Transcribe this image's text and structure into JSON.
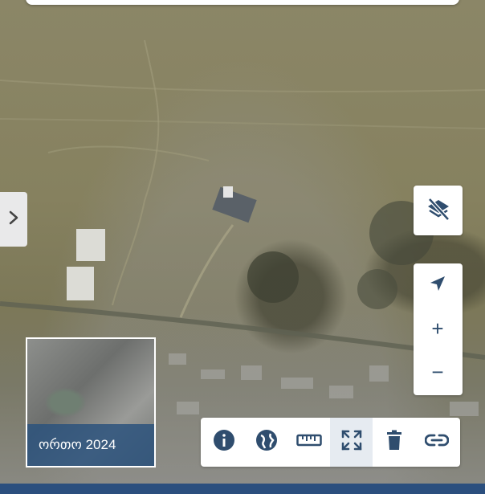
{
  "basemap": {
    "label": "ორთო 2024"
  },
  "side_panel": {
    "toggle_icon": "chevron-right-icon"
  },
  "map_controls": {
    "layers_icon": "layers-off-icon",
    "locate_icon": "navigation-arrow-icon",
    "zoom_in_label": "+",
    "zoom_out_label": "−"
  },
  "toolbar": {
    "tools": [
      {
        "icon": "info-icon"
      },
      {
        "icon": "globe-icon"
      },
      {
        "icon": "ruler-icon"
      },
      {
        "icon": "fullscreen-icon",
        "active": true
      },
      {
        "icon": "trash-icon"
      },
      {
        "icon": "link-icon"
      }
    ]
  },
  "colors": {
    "accent": "#2b4f7e",
    "icon": "#2f4d6e",
    "panel": "#ffffff"
  }
}
